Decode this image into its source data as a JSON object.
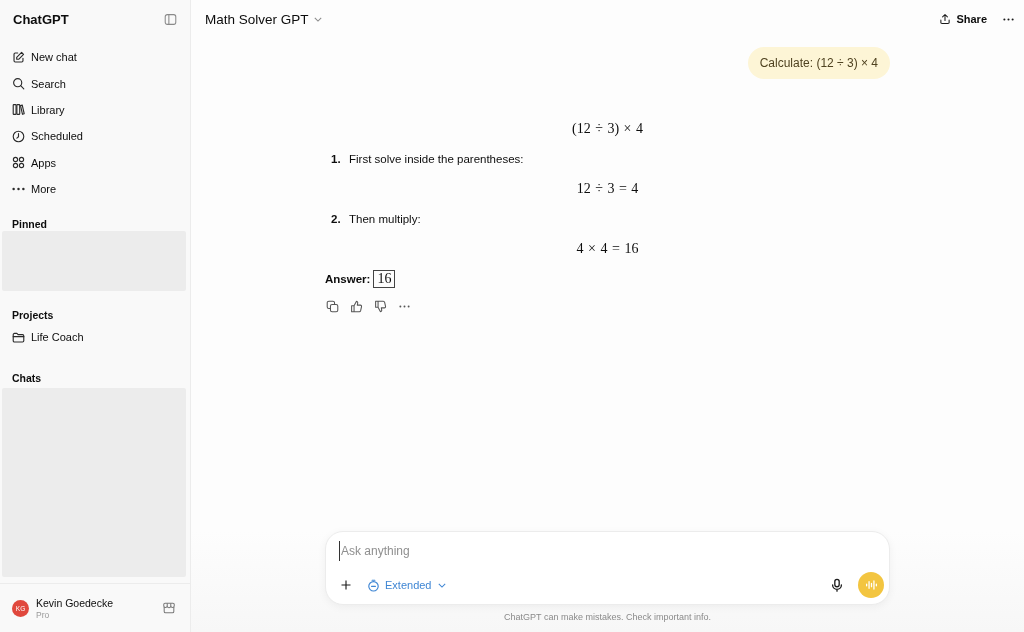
{
  "sidebar": {
    "title": "ChatGPT",
    "nav_items": [
      {
        "label": "New chat"
      },
      {
        "label": "Search"
      },
      {
        "label": "Library"
      },
      {
        "label": "Scheduled"
      },
      {
        "label": "Apps"
      },
      {
        "label": "More"
      }
    ],
    "sections": [
      {
        "heading": "Pinned",
        "redacted": true
      },
      {
        "heading": "Projects",
        "redacted": false,
        "items": [
          {
            "label": "Life Coach"
          }
        ]
      },
      {
        "heading": "Chats",
        "redacted": true
      }
    ],
    "account": {
      "initials": "KG",
      "name": "Kevin Goedecke",
      "plan": "Pro"
    }
  },
  "header": {
    "title": "Math Solver GPT",
    "share_label": "Share"
  },
  "conversation": {
    "user_message": "Calculate: (12 ÷ 3) × 4",
    "response": [
      {
        "kind": "math",
        "text": "(12 ÷ 3) × 4"
      },
      {
        "kind": "step",
        "number": "1.",
        "text": "First solve inside the parentheses:"
      },
      {
        "kind": "math",
        "text": "12 ÷ 3 = 4"
      },
      {
        "kind": "step",
        "number": "2.",
        "text": "Then multiply:"
      },
      {
        "kind": "math",
        "text": "4 × 4 = 16"
      },
      {
        "kind": "answer",
        "label": "Answer:",
        "value": "16"
      }
    ]
  },
  "composer": {
    "placeholder": "Ask anything",
    "mode_label": "Extended"
  },
  "disclaimer": "ChatGPT can make mistakes. Check important info."
}
